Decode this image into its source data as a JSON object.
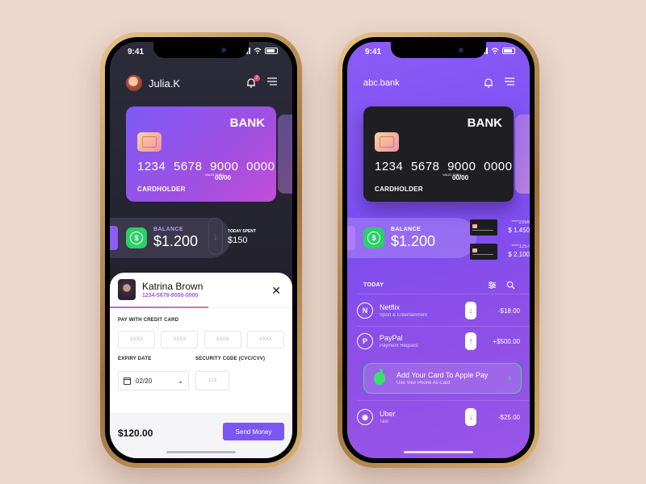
{
  "left_phone": {
    "status_time": "9:41",
    "user_name": "Julia.K",
    "notification_count": "2",
    "card": {
      "bank": "BANK",
      "number": "1234 5678 9000 0000",
      "valid_thru": "VALID THRU",
      "expiry": "00/00",
      "holder": "CARDHOLDER"
    },
    "balance": {
      "label": "BALANCE",
      "amount": "$1.200"
    },
    "today_spent": {
      "label": "TODAY SPENT",
      "amount": "$150"
    },
    "payment_sheet": {
      "recipient_name": "Katrina Brown",
      "recipient_card": "1234-5678-9000-0000",
      "pay_label": "PAY WITH CREDIT CARD",
      "digit_placeholders": [
        "XXXX",
        "XXXX",
        "XXXX",
        "XXXX"
      ],
      "expiry_label": "EXPIRY DATE",
      "expiry_value": "02/20",
      "security_label": "SECURITY CODE (CVC/CVV)",
      "security_placeholder": "123",
      "total": "$120.00",
      "send_button": "Send Money"
    }
  },
  "right_phone": {
    "status_time": "9:41",
    "title": "abc.bank",
    "card": {
      "bank": "BANK",
      "number": "1234 5678 9000 0000",
      "valid_thru": "VALID THRU",
      "expiry": "00/00",
      "holder": "CARDHOLDER"
    },
    "balance": {
      "label": "BALANCE",
      "amount": "$1.200"
    },
    "mini_cards": [
      {
        "masked": "****2356",
        "amount": "$ 1.450"
      },
      {
        "masked": "****1257",
        "amount": "$ 2.100"
      }
    ],
    "section_title": "TODAY",
    "transactions": [
      {
        "name": "Netflix",
        "category": "Sport & Entertainment",
        "amount": "-$18.00",
        "direction": "down",
        "icon": "netflix-icon"
      },
      {
        "name": "PayPal",
        "category": "Payment Request",
        "amount": "+$500.00",
        "direction": "up",
        "icon": "paypal-icon"
      },
      {
        "name": "Uber",
        "category": "Taxi",
        "amount": "-$25.00",
        "direction": "down",
        "icon": "uber-icon"
      }
    ],
    "apple_pay": {
      "title": "Add Your Card To Apple Pay",
      "subtitle": "Use Your Phone As Card"
    }
  },
  "colors": {
    "accent_purple": "#7c56f2",
    "apple_green": "#37e06f",
    "down_red": "#e74c6b",
    "up_green": "#21b95e"
  }
}
